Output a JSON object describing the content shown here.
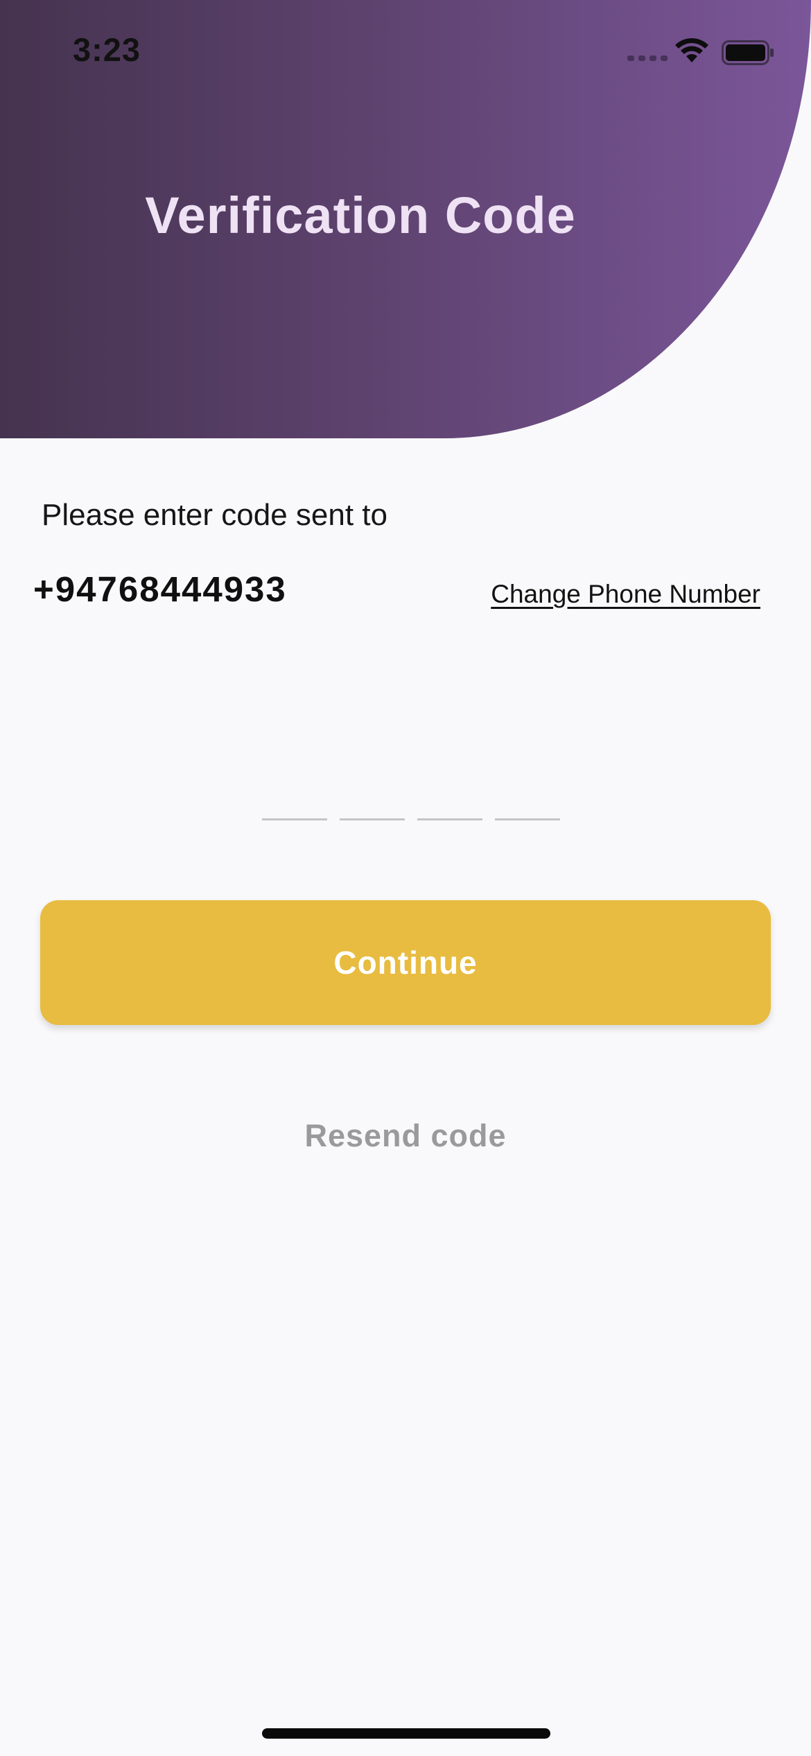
{
  "status_bar": {
    "time": "3:23",
    "icons": [
      "cellular-signal-icon",
      "wifi-icon",
      "battery-icon"
    ]
  },
  "header": {
    "title": "Verification Code",
    "gradient_colors": [
      "#45334f",
      "#7b5699"
    ]
  },
  "body": {
    "prompt": "Please enter code sent to",
    "phone_number": "+94768444933",
    "change_link": "Change Phone Number"
  },
  "otp": {
    "digit_count": 4,
    "values": [
      "",
      "",
      "",
      ""
    ]
  },
  "actions": {
    "continue_label": "Continue",
    "continue_color": "#e8bc41",
    "resend_label": "Resend code"
  }
}
